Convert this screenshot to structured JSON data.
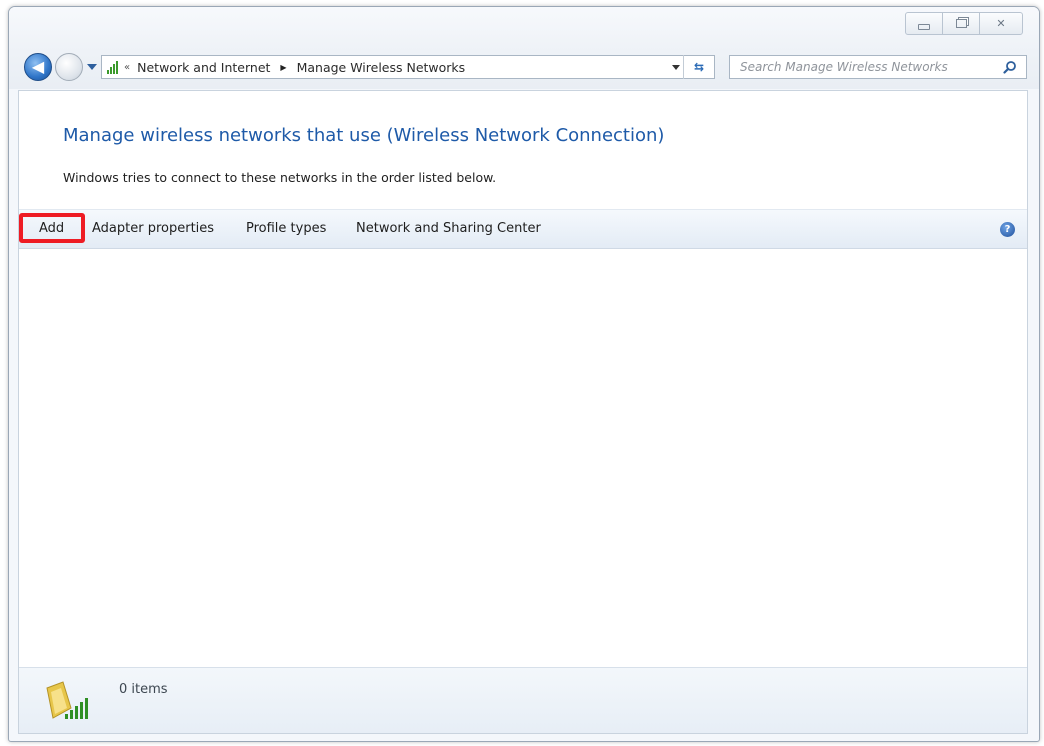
{
  "window": {
    "caption_buttons": [
      "minimize",
      "maximize",
      "close"
    ],
    "close_glyph": "✕"
  },
  "nav": {
    "back_glyph": "◀",
    "breadcrumb_sep": "«",
    "breadcrumbs": [
      "Network and Internet",
      "Manage Wireless Networks"
    ],
    "breadcrumb_arrow": "▶",
    "refresh_glyph": "⇆",
    "search_placeholder": "Search Manage Wireless Networks"
  },
  "main": {
    "heading": "Manage wireless networks that use (Wireless Network Connection)",
    "description": "Windows tries to connect to these networks in the order listed below."
  },
  "toolbar": {
    "add_label": "Add",
    "adapter_label": "Adapter properties",
    "profile_label": "Profile types",
    "sharing_label": "Network and Sharing Center",
    "help_glyph": "?"
  },
  "status": {
    "items_label": "0 items"
  },
  "colors": {
    "highlight": "#ee1c24",
    "heading": "#1e5aa8",
    "signal": "#3b9a2c"
  },
  "icons": {
    "help": "help-icon",
    "search": "search-icon",
    "network": "wireless-network-icon"
  }
}
